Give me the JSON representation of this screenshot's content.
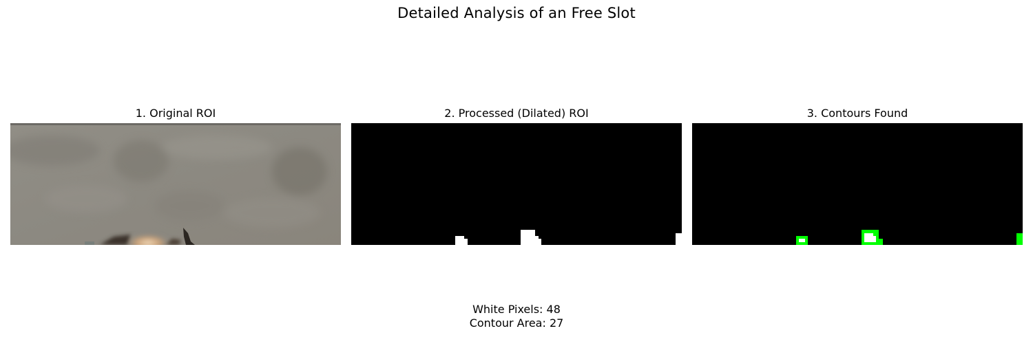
{
  "figure": {
    "title": "Detailed Analysis of an Free Slot"
  },
  "panels": [
    {
      "title": "1. Original ROI"
    },
    {
      "title": "2. Processed (Dilated) ROI"
    },
    {
      "title": "3. Contours Found"
    }
  ],
  "stats": {
    "white_pixels": "White Pixels: 48",
    "contour_area": "Contour Area: 27"
  },
  "colors": {
    "background": "#ffffff",
    "mask_background": "#000000",
    "mask_foreground": "#ffffff",
    "contour": "#00ff00",
    "asphalt": "#8e8a82"
  }
}
